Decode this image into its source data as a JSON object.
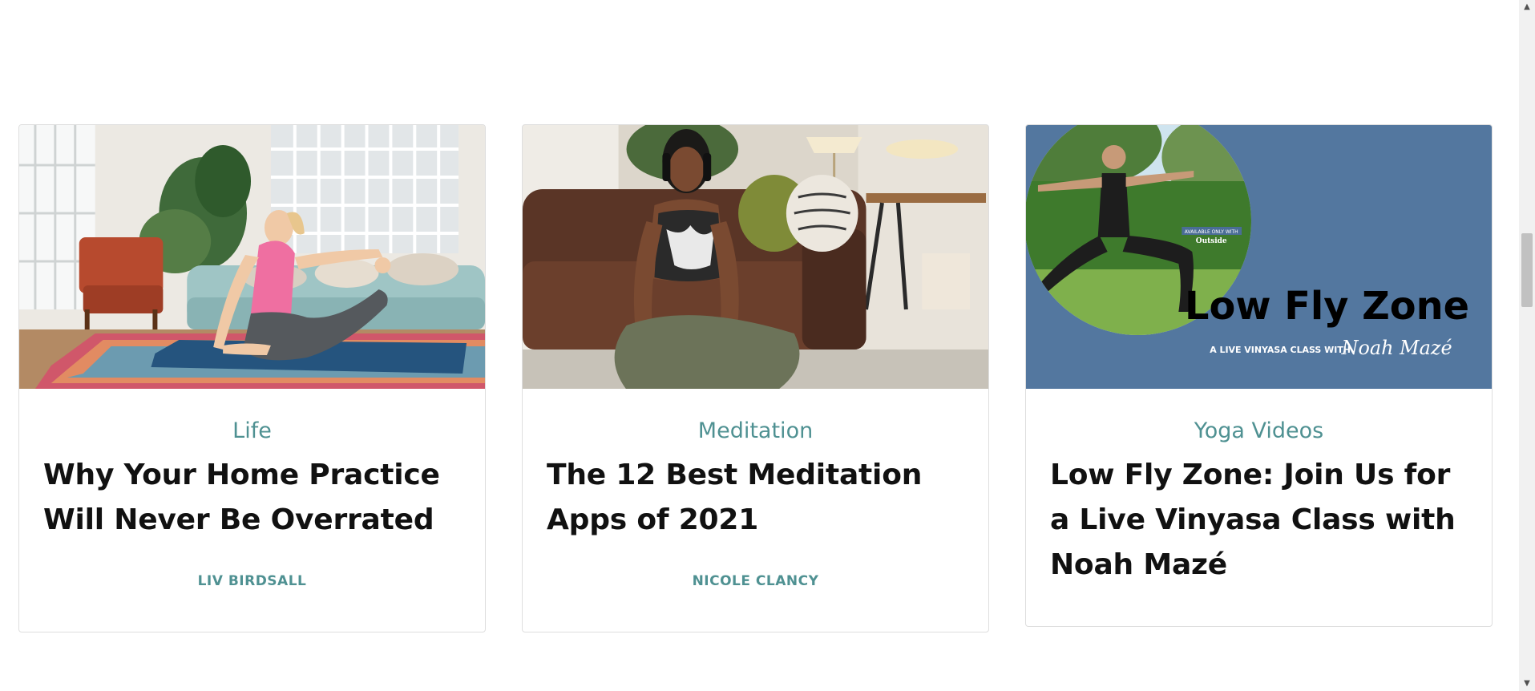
{
  "cards": [
    {
      "image_alt": "Woman in pink top stretching on a yoga mat in a bright living room",
      "category": "Life",
      "title": "Why Your Home Practice Will Never Be Overrated",
      "author": "LIV BIRDSALL"
    },
    {
      "image_alt": "Woman wearing headphones meditating cross-legged in front of a leather sofa",
      "category": "Meditation",
      "title": "The 12 Best Meditation Apps of 2021",
      "author": "NICOLE CLANCY"
    },
    {
      "image_alt": "Low Fly Zone promo with man in warrior pose inside a circle",
      "category": "Yoga Videos",
      "title": "Low Fly Zone: Join Us for a Live Vinyasa Class with Noah Mazé",
      "author": "",
      "promo": {
        "headline": "Low Fly Zone",
        "subline": "A LIVE VINYASA CLASS WITH",
        "signature": "Noah Mazé",
        "badge_top": "AVAILABLE ONLY WITH",
        "badge_brand": "Outside",
        "bg_color": "#53779f"
      }
    }
  ],
  "colors": {
    "accent": "#4f9192",
    "title": "#111111",
    "card_border": "#dedede"
  }
}
